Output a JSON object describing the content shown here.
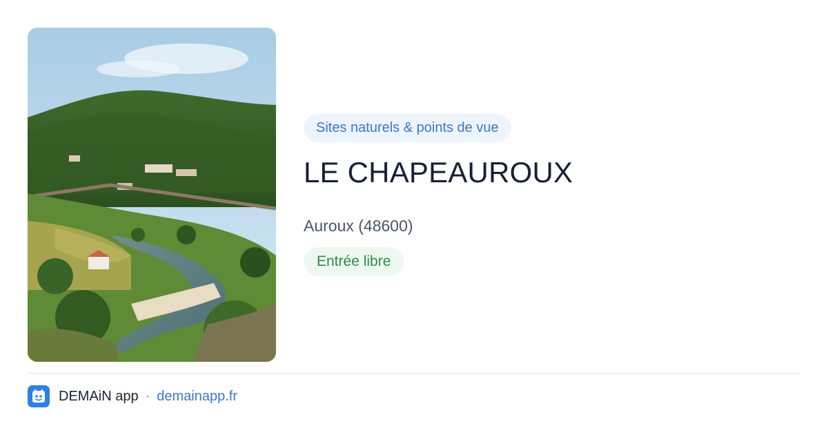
{
  "place": {
    "category": "Sites naturels & points de vue",
    "name": "LE CHAPEAUROUX",
    "location": "Auroux (48600)",
    "access": "Entrée libre"
  },
  "footer": {
    "app_name": "DEMAiN app",
    "separator": "·",
    "link_text": "demainapp.fr"
  },
  "colors": {
    "category_badge_bg": "#eef4fd",
    "category_badge_text": "#3a78c8",
    "access_badge_bg": "#edf9f0",
    "access_badge_text": "#2f8a45",
    "brand_blue": "#2f7fe6"
  },
  "icons": {
    "app_logo": "demain-app-logo-icon"
  }
}
